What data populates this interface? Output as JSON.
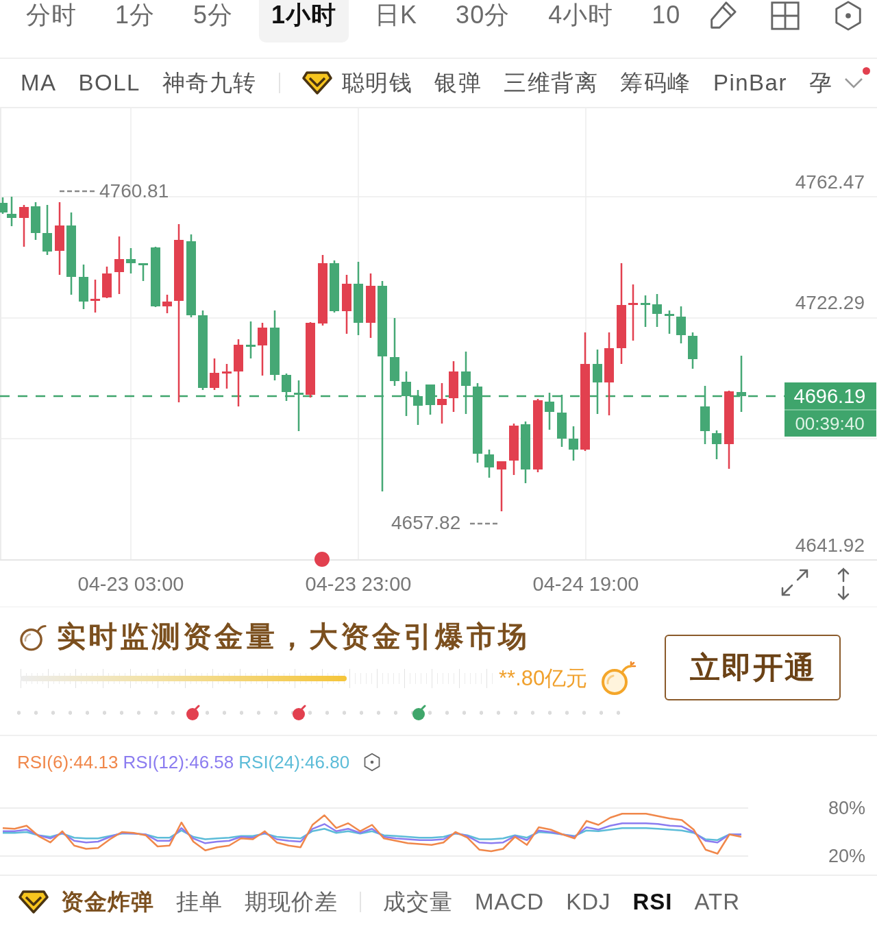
{
  "period_tabs": [
    {
      "label": "分时",
      "selected": false
    },
    {
      "label": "1分",
      "selected": false
    },
    {
      "label": "5分",
      "selected": false
    },
    {
      "label": "1小时",
      "selected": true
    },
    {
      "label": "日K",
      "selected": false
    },
    {
      "label": "30分",
      "selected": false
    },
    {
      "label": "4小时",
      "selected": false
    },
    {
      "label": "10",
      "selected": false
    }
  ],
  "indicator_bar": {
    "groups": [
      {
        "items": [
          {
            "label": "MA",
            "kind": "plain",
            "selected": false
          },
          {
            "label": "BOLL",
            "kind": "plain",
            "selected": false
          },
          {
            "label": "神奇九转",
            "kind": "plain",
            "selected": false
          }
        ]
      },
      {
        "items": [
          {
            "label": "聪明钱",
            "kind": "premium",
            "selected": false
          },
          {
            "label": "银弹",
            "kind": "plain",
            "selected": false
          },
          {
            "label": "三维背离",
            "kind": "plain",
            "selected": false
          },
          {
            "label": "筹码峰",
            "kind": "plain",
            "selected": false
          },
          {
            "label": "PinBar",
            "kind": "plain",
            "selected": false
          },
          {
            "label": "孕",
            "kind": "plain",
            "selected": false
          }
        ]
      }
    ],
    "notification": true
  },
  "price_chart": {
    "axis_labels": [
      "4762.47",
      "4722.29",
      "4641.92"
    ],
    "high_label": "4760.81",
    "low_label": "4657.82",
    "current_price": "4696.19",
    "countdown": "00:39:40",
    "time_labels": [
      "04-23 03:00",
      "04-23 23:00",
      "04-24 19:00"
    ]
  },
  "promo": {
    "headline": "实时监测资金量，大资金引爆市场",
    "meter": {
      "level": 0.69
    },
    "amount": "**.80亿元",
    "markers": [
      {
        "color": "#e2404f"
      },
      {
        "color": "#e2404f"
      },
      {
        "color": "#3fa66a"
      }
    ],
    "button": "立即开通"
  },
  "rsi": {
    "legend": [
      {
        "label": "RSI(6):44.13",
        "color": "#f0874a"
      },
      {
        "label": "RSI(12):46.58",
        "color": "#8b7cf0"
      },
      {
        "label": "RSI(24):46.80",
        "color": "#5cbcd8"
      }
    ],
    "chart_data": {
      "type": "line",
      "ylim": [
        20,
        80
      ],
      "yticks": [
        {
          "value": 80,
          "label": "80%"
        },
        {
          "value": 20,
          "label": "20%"
        }
      ],
      "series": [
        {
          "color": "#5cbcd8",
          "values": [
            49,
            49,
            50,
            46,
            44,
            48,
            43,
            42,
            42,
            45,
            48,
            48,
            47,
            43,
            43,
            52,
            44,
            41,
            42,
            43,
            45,
            45,
            48,
            44,
            43,
            42,
            51,
            54,
            49,
            51,
            48,
            51,
            46,
            45,
            44,
            43,
            43,
            44,
            48,
            46,
            41,
            41,
            42,
            46,
            43,
            50,
            49,
            47,
            45,
            52,
            51,
            53,
            55,
            55,
            55,
            54,
            53,
            52,
            49,
            41,
            40,
            47,
            47
          ]
        },
        {
          "color": "#8b7cf0",
          "values": [
            51,
            51,
            53,
            46,
            42,
            49,
            39,
            37,
            38,
            44,
            49,
            48,
            47,
            39,
            39,
            55,
            42,
            36,
            38,
            39,
            44,
            43,
            49,
            41,
            39,
            38,
            54,
            60,
            51,
            54,
            49,
            54,
            44,
            42,
            41,
            40,
            40,
            41,
            49,
            45,
            37,
            36,
            37,
            45,
            40,
            52,
            50,
            47,
            44,
            56,
            53,
            58,
            61,
            61,
            61,
            60,
            58,
            57,
            50,
            39,
            37,
            47,
            47
          ]
        },
        {
          "color": "#f0874a",
          "values": [
            55,
            54,
            58,
            45,
            37,
            51,
            33,
            29,
            30,
            41,
            50,
            49,
            46,
            32,
            33,
            62,
            38,
            27,
            31,
            33,
            42,
            41,
            51,
            37,
            33,
            31,
            59,
            71,
            55,
            61,
            51,
            59,
            42,
            39,
            36,
            35,
            34,
            37,
            50,
            43,
            28,
            26,
            29,
            44,
            34,
            56,
            53,
            47,
            42,
            64,
            59,
            68,
            73,
            73,
            73,
            70,
            67,
            65,
            53,
            28,
            23,
            47,
            44
          ]
        }
      ]
    }
  },
  "bottom_tabs": {
    "groups": [
      {
        "items": [
          {
            "label": "资金炸弹",
            "kind": "premium",
            "selected": false
          },
          {
            "label": "挂单",
            "kind": "plain",
            "selected": false
          },
          {
            "label": "期现价差",
            "kind": "plain",
            "selected": false
          }
        ]
      },
      {
        "items": [
          {
            "label": "成交量",
            "kind": "plain",
            "selected": false
          },
          {
            "label": "MACD",
            "kind": "plain",
            "selected": false
          },
          {
            "label": "KDJ",
            "kind": "plain",
            "selected": false
          },
          {
            "label": "RSI",
            "kind": "plain",
            "selected": true
          },
          {
            "label": "ATR",
            "kind": "plain",
            "selected": false
          }
        ]
      }
    ]
  }
}
